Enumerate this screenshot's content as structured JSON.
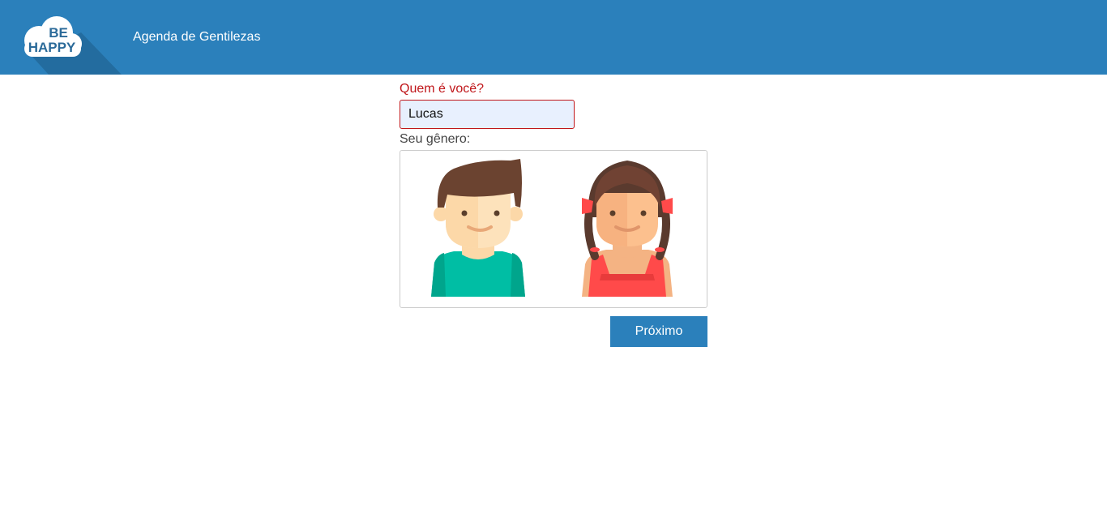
{
  "header": {
    "logo_text_line1": "BE",
    "logo_text_line2": "HAPPY",
    "title": "Agenda de Gentilezas"
  },
  "form": {
    "name_label": "Quem é você?",
    "name_value": "Lucas",
    "gender_label": "Seu gênero:",
    "gender_options": [
      {
        "name": "boy-avatar",
        "icon": "boy-avatar-icon"
      },
      {
        "name": "girl-avatar",
        "icon": "girl-avatar-icon"
      }
    ],
    "next_label": "Próximo"
  },
  "colors": {
    "header_bg": "#2b80bb",
    "error_red": "#c0161a",
    "input_bg": "#e8f0fe",
    "button_bg": "#2b80bb"
  }
}
